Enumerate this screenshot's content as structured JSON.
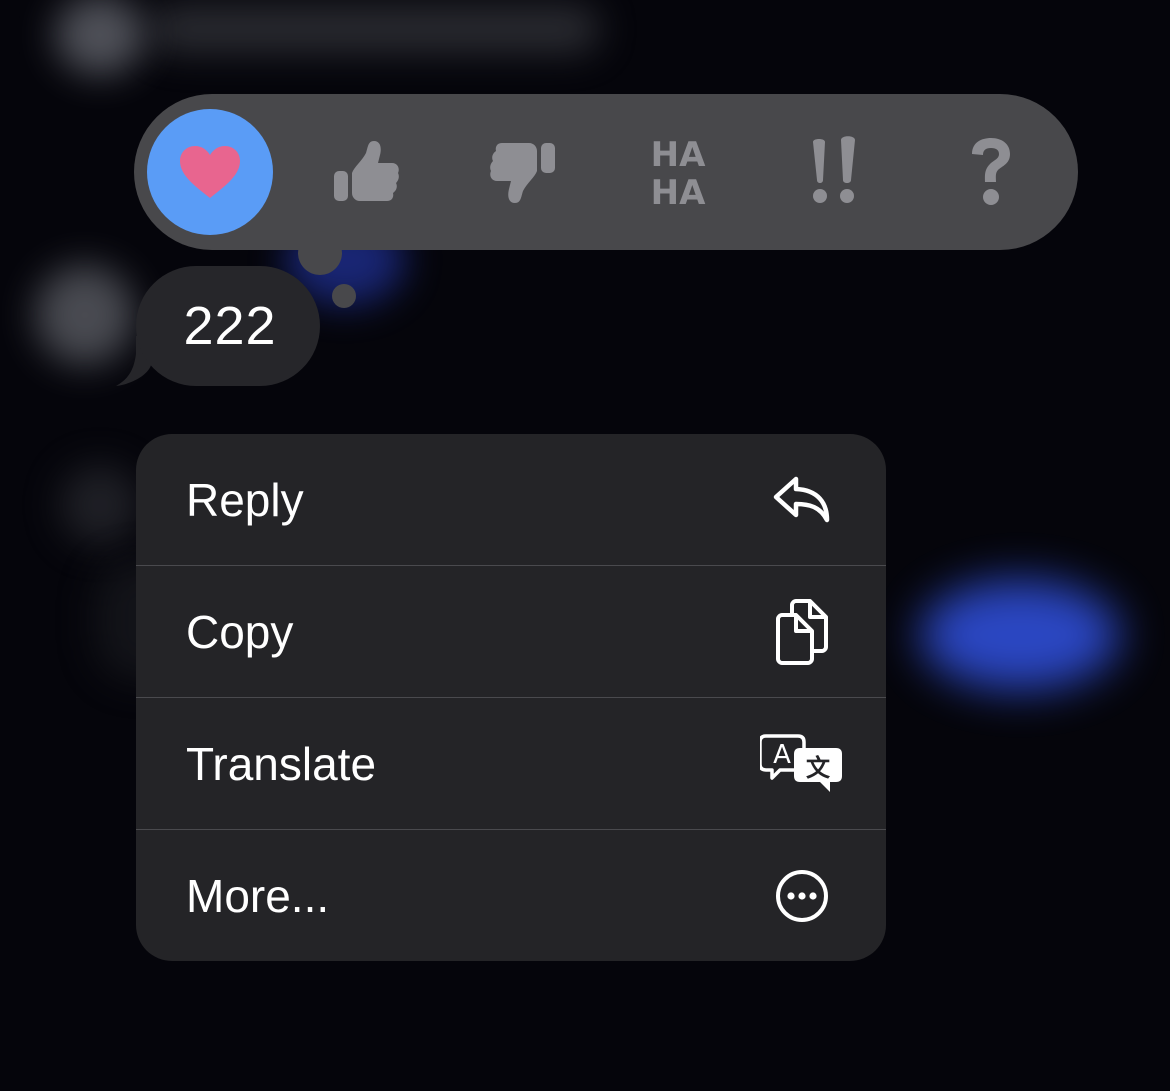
{
  "tapback": {
    "reactions": [
      {
        "name": "heart",
        "label": "",
        "selected": true
      },
      {
        "name": "thumbs-up",
        "label": "",
        "selected": false
      },
      {
        "name": "thumbs-down",
        "label": "",
        "selected": false
      },
      {
        "name": "haha",
        "label_top": "HA",
        "label_bottom": "HA",
        "selected": false
      },
      {
        "name": "exclamation",
        "label": "!!",
        "selected": false
      },
      {
        "name": "question",
        "label": "?",
        "selected": false
      }
    ],
    "selected_color": "#5a9cf6",
    "heart_color": "#e8658f",
    "icon_color": "#8e8e93"
  },
  "message": {
    "text": "222"
  },
  "menu": {
    "items": [
      {
        "label": "Reply",
        "icon": "reply-arrow-icon"
      },
      {
        "label": "Copy",
        "icon": "copy-documents-icon"
      },
      {
        "label": "Translate",
        "icon": "translate-icon"
      },
      {
        "label": "More...",
        "icon": "ellipsis-circle-icon"
      }
    ]
  }
}
